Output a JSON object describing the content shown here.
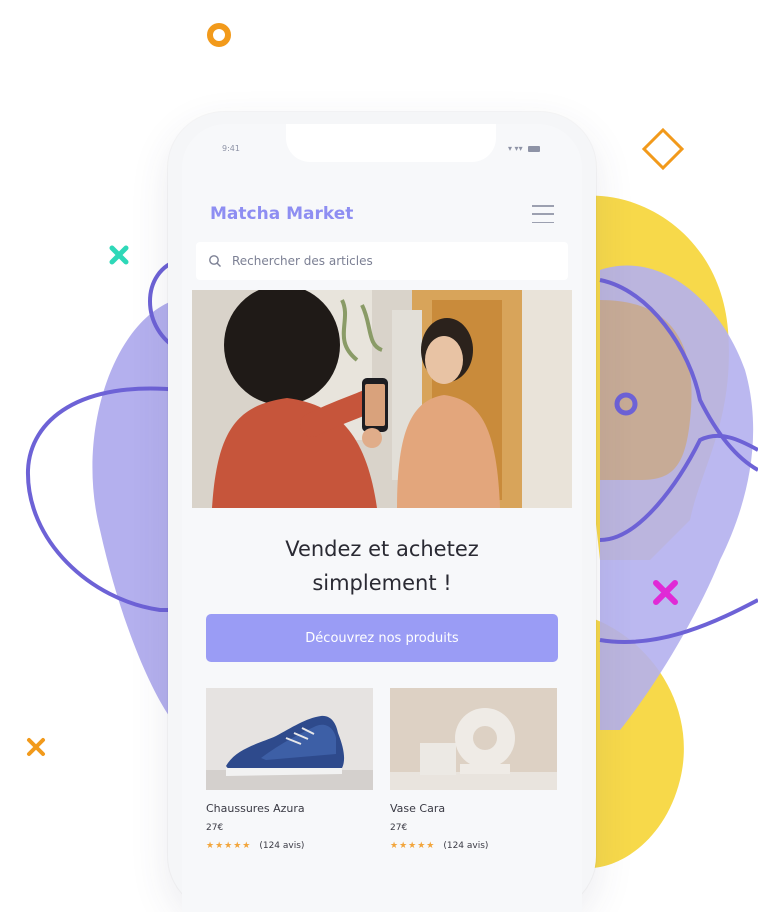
{
  "status": {
    "time": "9:41",
    "signal": "▾ ▾▾"
  },
  "header": {
    "brand": "Matcha Market",
    "menu_icon": "hamburger-icon"
  },
  "search": {
    "placeholder": "Rechercher des articles",
    "icon": "search-icon"
  },
  "hero": {
    "image": "two-women-phone-photo"
  },
  "headline": {
    "line1": "Vendez et achetez",
    "line2": "simplement !"
  },
  "cta": {
    "label": "Découvrez nos produits"
  },
  "products": [
    {
      "name": "Chaussures Azura",
      "price": "27€",
      "stars": "★★★★★",
      "reviews": "(124 avis)",
      "image": "blue-sneaker"
    },
    {
      "name": "Vase Cara",
      "price": "27€",
      "stars": "★★★★★",
      "reviews": "(124 avis)",
      "image": "white-ring-vase"
    }
  ],
  "colors": {
    "accent": "#9a9cf5",
    "brand": "#8e8ef2",
    "blob_purple": "#b4b0ee",
    "blob_yellow": "#f7d94a",
    "outline_purple": "#6d62d6",
    "orange": "#f29a1b",
    "teal": "#2ed8b8",
    "magenta": "#e02ad6"
  }
}
